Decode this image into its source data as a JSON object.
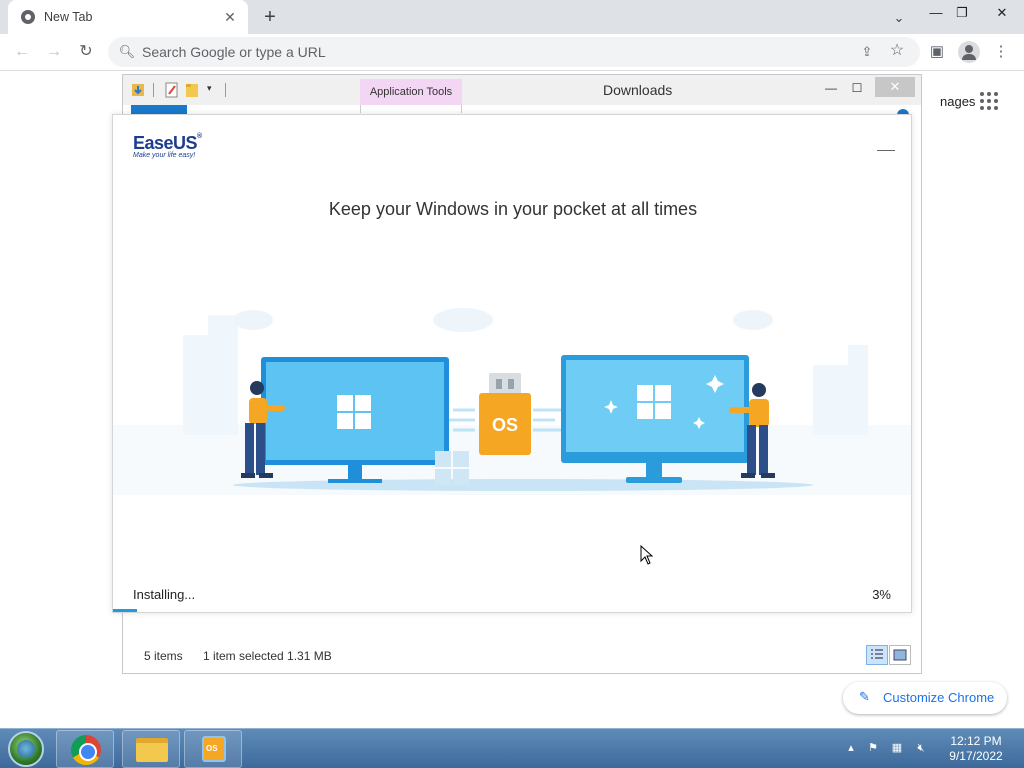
{
  "browser": {
    "tab_title": "New Tab",
    "omnibox_placeholder": "Search Google or type a URL",
    "ntp_images_link": "nages",
    "customize_label": "Customize Chrome"
  },
  "explorer": {
    "ribbon_context_tab": "Application Tools",
    "title": "Downloads",
    "status_items": "5 items",
    "status_selected": "1 item selected  1.31 MB"
  },
  "installer": {
    "brand": "EaseUS",
    "tagline": "Make your life easy!",
    "headline": "Keep your Windows in your pocket at all times",
    "usb_label": "OS",
    "status": "Installing...",
    "percent_label": "3%",
    "progress_fraction": 0.03
  },
  "taskbar": {
    "time": "12:12 PM",
    "date": "9/17/2022"
  },
  "colors": {
    "accent": "#1f9be0",
    "chrome_link": "#1a73e8",
    "app_tools_tab": "#f3d6f4"
  }
}
